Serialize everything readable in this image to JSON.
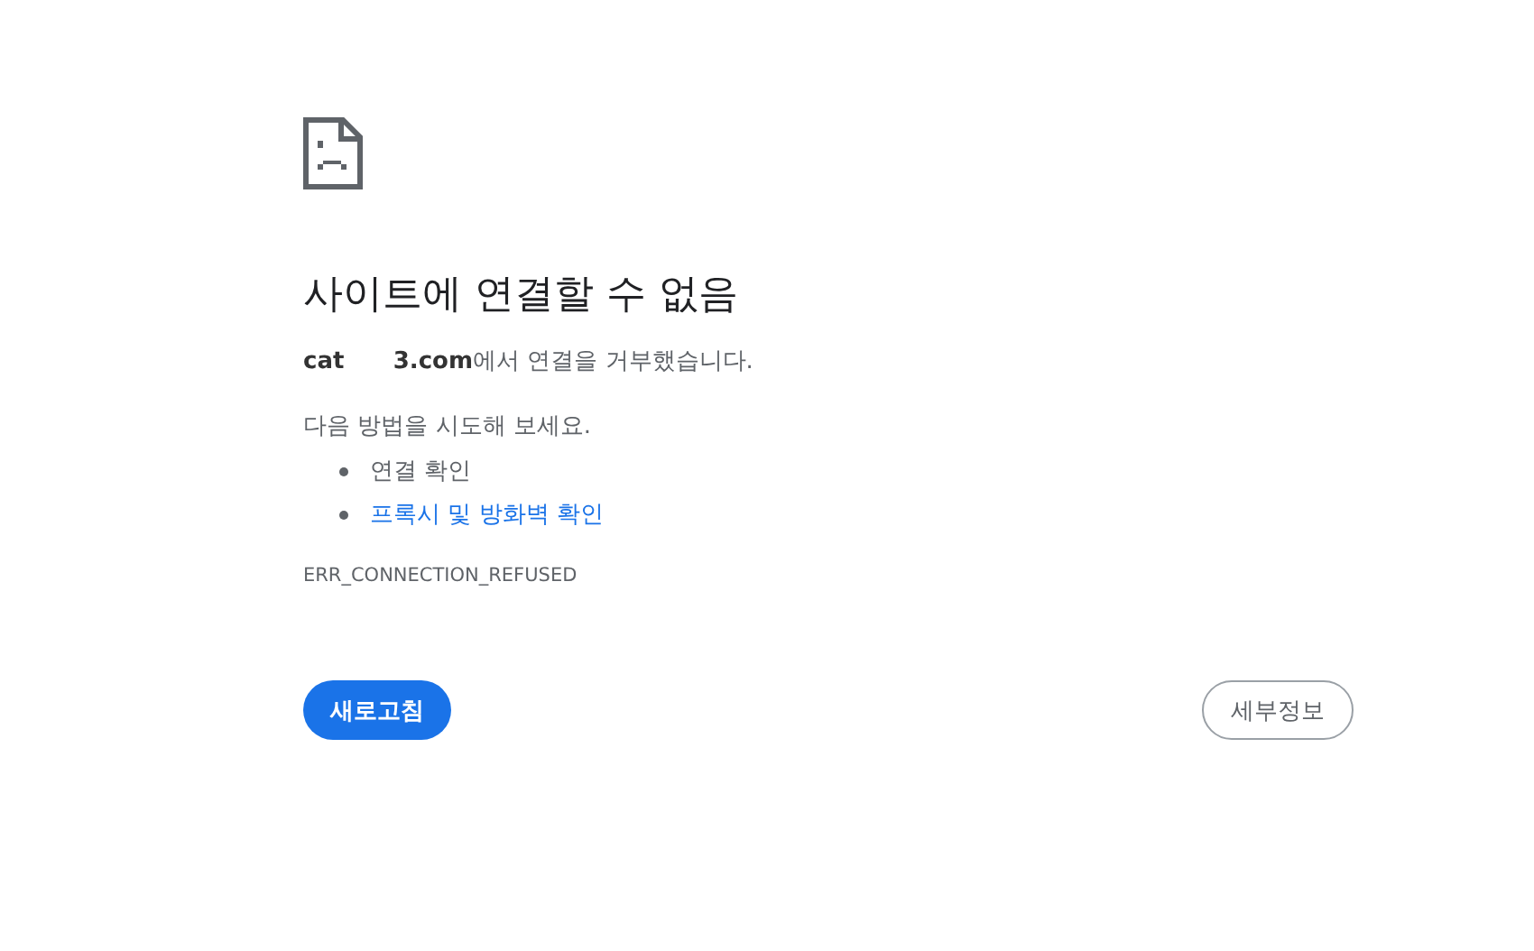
{
  "error_page": {
    "title": "사이트에 연결할 수 없음",
    "message": "**cat      3.com**에서 연결을 거부했습니다.",
    "suggestions_heading": "다음 방법을 시도해 보세요.",
    "suggestions": [
      {
        "kind": "text",
        "text": "연결 확인"
      },
      {
        "kind": "link",
        "text": "프록시 및 방화벽 확인"
      }
    ],
    "error_code": "ERR_CONNECTION_REFUSED",
    "buttons": [
      {
        "kind": "primary",
        "label": "새로고침"
      },
      {
        "kind": "secondary",
        "label": "세부정보"
      }
    ]
  }
}
